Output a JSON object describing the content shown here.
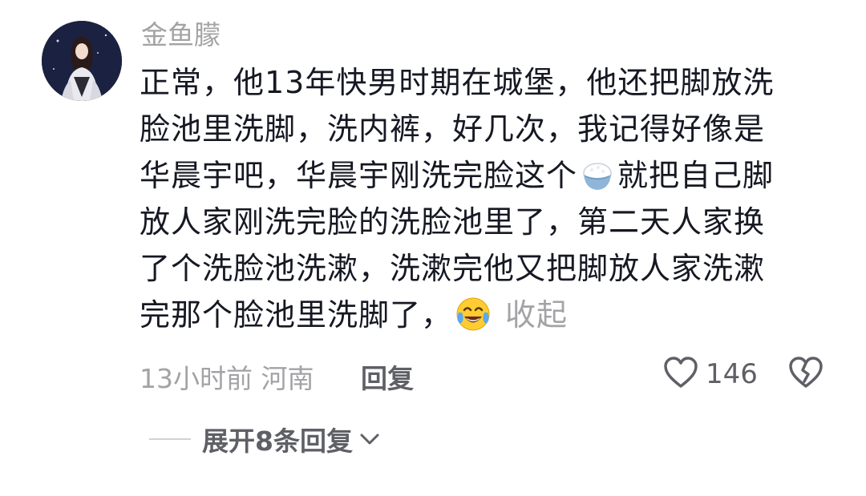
{
  "comment": {
    "username": "金鱼朦",
    "lines": [
      "正常，他13年快男时期在城堡，他还把脚放洗",
      "脸池里洗脚，洗内裤，好几次，我记得好像是",
      "华晨宇吧，华晨宇刚洗完脸这个",
      "就把自己脚",
      "放人家刚洗完脸的洗脸池里了，第二天人家换",
      "了个洗脸池洗漱，洗漱完他又把脚放人家洗漱",
      "完那个脸池里洗脚了，"
    ],
    "collapse_label": "收起",
    "meta": {
      "time_location": "13小时前 河南",
      "reply_label": "回复"
    },
    "like_count": "146",
    "expand_label": "展开8条回复"
  },
  "icons": {
    "avatar": "avatar-image",
    "rice_emoji": "rice-bowl-emoji",
    "laugh_emoji": "tears-of-joy-emoji",
    "like": "heart-outline-icon",
    "dislike": "broken-heart-icon",
    "expand": "chevron-down-icon"
  },
  "colors": {
    "text_primary": "#161823",
    "text_secondary": "#a3a3a6",
    "text_action": "#5f6066"
  }
}
